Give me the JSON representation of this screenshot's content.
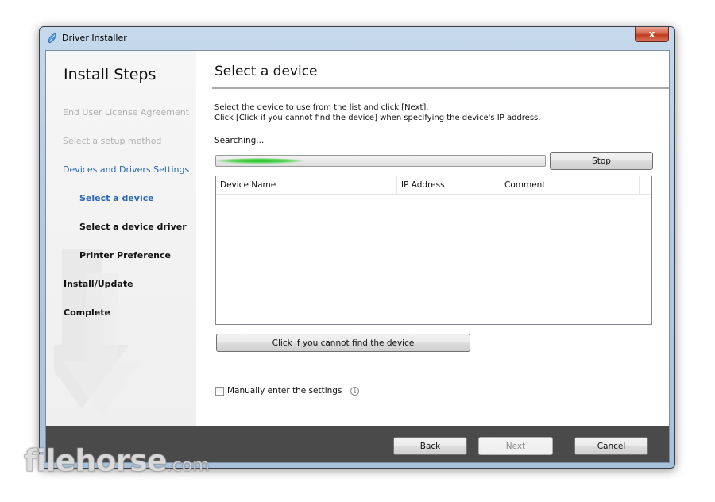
{
  "window": {
    "title": "Driver Installer",
    "close_label": "x"
  },
  "sidebar": {
    "title": "Install Steps",
    "steps": [
      {
        "label": "End User License Agreement",
        "state": "done"
      },
      {
        "label": "Select a setup method",
        "state": "done"
      },
      {
        "label": "Devices and Drivers Settings",
        "state": "active"
      },
      {
        "label": "Select a device",
        "state": "current"
      },
      {
        "label": "Select a device driver",
        "state": "pending"
      },
      {
        "label": "Printer Preference",
        "state": "pending"
      },
      {
        "label": "Install/Update",
        "state": "pending"
      },
      {
        "label": "Complete",
        "state": "pending"
      }
    ]
  },
  "main": {
    "title": "Select a device",
    "instruction_1": "Select the device to use from the list and click [Next].",
    "instruction_2": "Click [Click if you cannot find the device] when specifying the device's IP address.",
    "status": "Searching...",
    "stop_label": "Stop",
    "columns": [
      "Device Name",
      "IP Address",
      "Comment"
    ],
    "find_device_label": "Click if you cannot find the device",
    "manual_label": "Manually enter the settings",
    "manual_checked": false,
    "info_glyph": "i"
  },
  "footer": {
    "back_label": "Back",
    "next_label": "Next",
    "cancel_label": "Cancel"
  },
  "watermark": {
    "text": "filehorse",
    "suffix": ".com"
  },
  "colors": {
    "accent": "#2a68b8",
    "footer": "#4a4a4a",
    "progress": "#29c22c"
  }
}
